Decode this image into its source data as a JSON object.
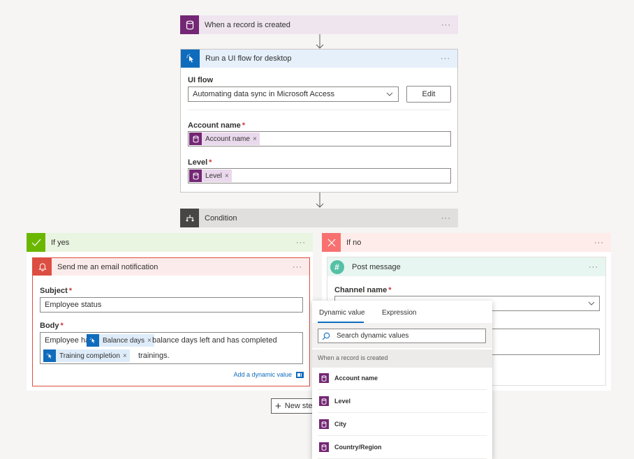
{
  "trigger": {
    "title": "When a record is created",
    "more": "···"
  },
  "ui_flow_step": {
    "title": "Run a UI flow for desktop",
    "more": "···",
    "ui_flow_label": "UI flow",
    "ui_flow_value": "Automating data sync in Microsoft Access",
    "edit_label": "Edit",
    "account_label": "Account name",
    "account_token": "Account name",
    "level_label": "Level",
    "level_token": "Level",
    "required_mark": "*",
    "remove_mark": "×"
  },
  "condition": {
    "title": "Condition",
    "more": "···"
  },
  "if_yes": {
    "title": "If yes",
    "more": "···",
    "email": {
      "title": "Send me an email notification",
      "more": "···",
      "subject_label": "Subject",
      "subject_value": "Employee status",
      "body_label": "Body",
      "body_text_1": "Employee has",
      "body_token_1": "Balance days",
      "body_text_2": "balance days left and has completed",
      "body_token_2": "Training completion",
      "body_text_3": "trainings.",
      "add_dynamic_label": "Add a dynamic value"
    }
  },
  "if_no": {
    "title": "If no",
    "more": "···",
    "post": {
      "title": "Post message",
      "more": "···",
      "channel_label": "Channel name"
    }
  },
  "new_step": {
    "label": "New step",
    "plus": "+"
  },
  "dynamic_panel": {
    "tabs": [
      "Dynamic value",
      "Expression"
    ],
    "search_placeholder": "Search dynamic values",
    "section": "When a record is created",
    "items": [
      "Account name",
      "Level",
      "City",
      "Country/Region"
    ]
  },
  "colors": {
    "trigger": "#742774",
    "ui_flow": "#0f6cbd",
    "condition": "#484644",
    "yes": "#6bb700",
    "no": "#f87171",
    "email": "#dc4e41",
    "slack": "#55c0a5"
  }
}
